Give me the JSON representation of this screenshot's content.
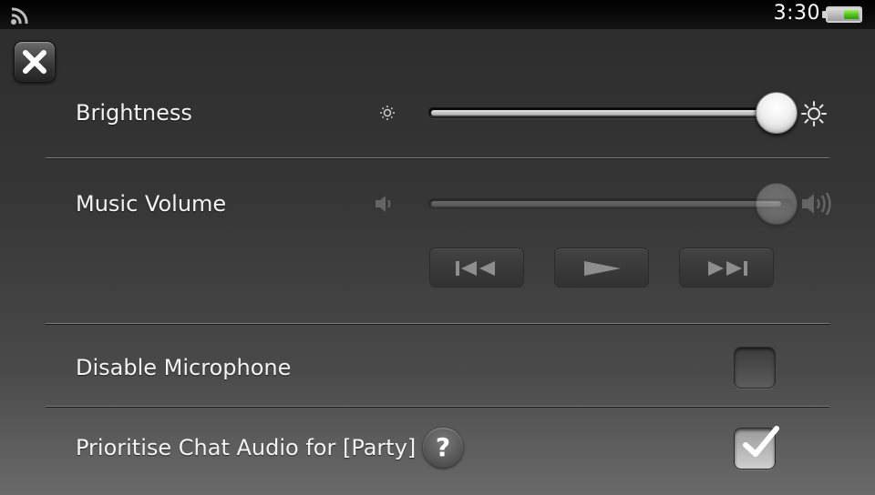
{
  "status_bar": {
    "time": "3:30",
    "signal_icon": "wifi-broadcast-icon",
    "battery_icon": "battery-icon",
    "battery_color": "#51c01a"
  },
  "close_button": {
    "icon": "close-icon"
  },
  "settings": {
    "brightness": {
      "label": "Brightness",
      "level": 0.97,
      "min_icon": "brightness-low-icon",
      "max_icon": "brightness-high-icon"
    },
    "music_volume": {
      "label": "Music Volume",
      "level": 0.98,
      "enabled": false,
      "min_icon": "volume-low-icon",
      "max_icon": "volume-high-icon",
      "controls": [
        "previous-track-icon",
        "play-icon",
        "next-track-icon"
      ]
    },
    "disable_microphone": {
      "label": "Disable Microphone",
      "checked": false
    },
    "prioritise_chat_audio": {
      "label": "Prioritise Chat Audio for [Party]",
      "checked": true,
      "help_icon": "?"
    }
  }
}
